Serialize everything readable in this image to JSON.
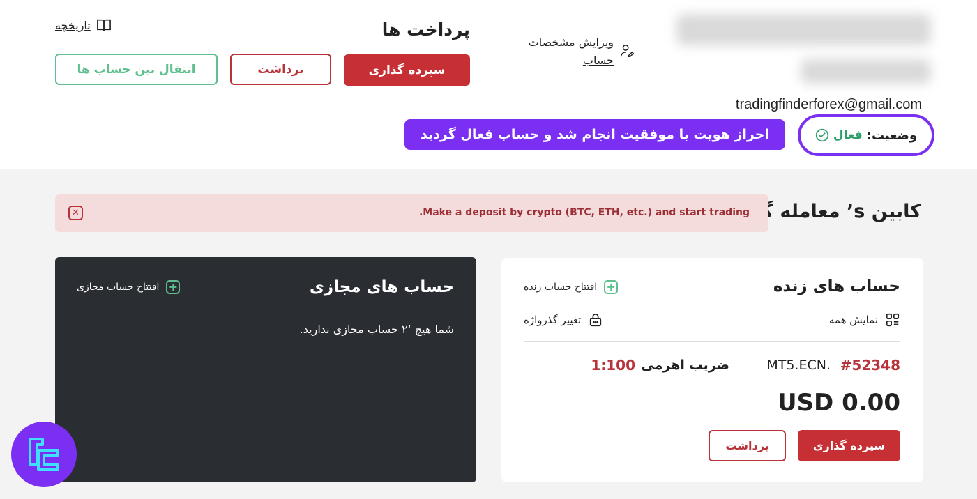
{
  "header": {
    "edit_profile_label": "ویرایش مشخصات حساب",
    "email": "tradingfinderforex@gmail.com",
    "status_label": "وضعیت:",
    "status_value": "فعال",
    "verify_banner": "احراز هویت با موفقیت انجام شد و حساب فعال گردید"
  },
  "payments": {
    "title": "پرداخت ها",
    "history_label": "تاریخچه",
    "deposit_label": "سپرده گذاری",
    "withdraw_label": "برداشت",
    "transfer_label": "انتقال بین حساب ها"
  },
  "cabin": {
    "title": "کابین s’ معامله گر",
    "alert_message": ".Make a deposit by crypto (BTC, ETH, etc.) and start trading"
  },
  "demo_accounts": {
    "title": "حساب های مجازی",
    "open_label": "افتتاح حساب مجازی",
    "empty_message": "شما هیچ ‘۲ حساب مجازی ندارید."
  },
  "live_accounts": {
    "title": "حساب های زنده",
    "open_label": "افتتاح حساب زنده",
    "show_all_label": "نمایش همه",
    "change_password_label": "تغییر گذرواژه",
    "account": {
      "number": "#52348",
      "type": "MT5.ECN.",
      "leverage_label": "ضریب اهرمی",
      "leverage_value": "1:100",
      "balance": "USD 0.00"
    },
    "deposit_label": "سپرده گذاری",
    "withdraw_label": "برداشت"
  },
  "colors": {
    "accent_purple": "#7b2ff2",
    "primary_red": "#c62f33",
    "success_green": "#5fbf8f",
    "dark_card": "#2a2d31"
  }
}
